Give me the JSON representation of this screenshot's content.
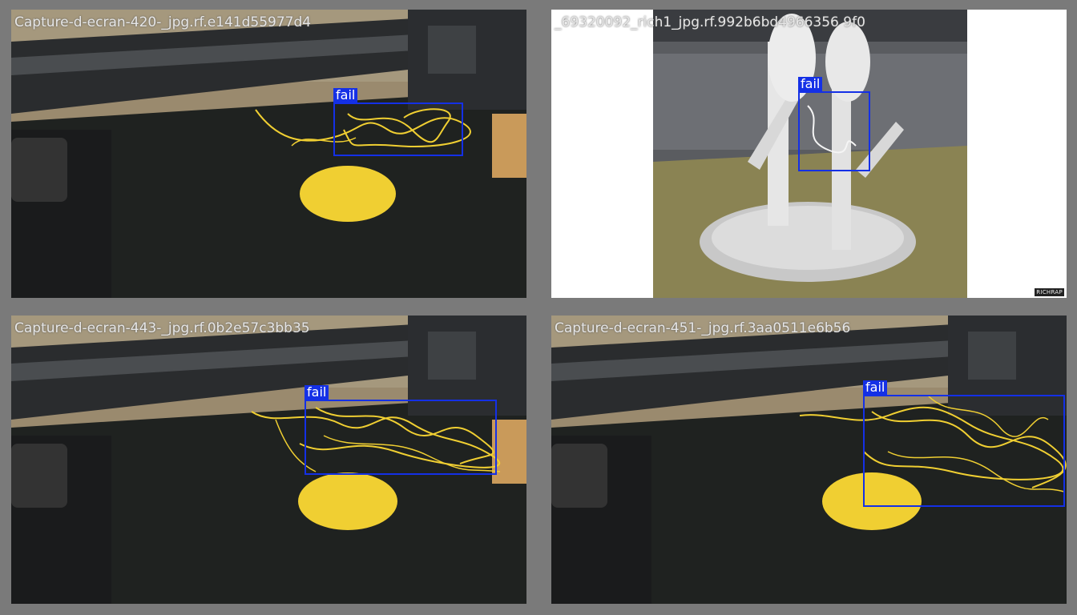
{
  "grid": {
    "tiles": [
      {
        "filename": "Capture-d-ecran-420-_jpg.rf.e141d55977d4",
        "detections": [
          {
            "label": "fail"
          }
        ],
        "scene": "printer-bed"
      },
      {
        "filename": "_69320092_rich1_jpg.rf.992b6bd4966356 9f0",
        "detections": [
          {
            "label": "fail"
          }
        ],
        "scene": "white-figure",
        "watermark": "RICHRAP"
      },
      {
        "filename": "Capture-d-ecran-443-_jpg.rf.0b2e57c3bb35",
        "detections": [
          {
            "label": "fail"
          }
        ],
        "scene": "printer-bed"
      },
      {
        "filename": "Capture-d-ecran-451-_jpg.rf.3aa0511e6b56",
        "detections": [
          {
            "label": "fail"
          }
        ],
        "scene": "printer-bed"
      }
    ]
  },
  "colors": {
    "box": "#1430e6",
    "filament": "#f0cf32",
    "bed": "#1f2220",
    "frame": "#7a7a7a"
  }
}
